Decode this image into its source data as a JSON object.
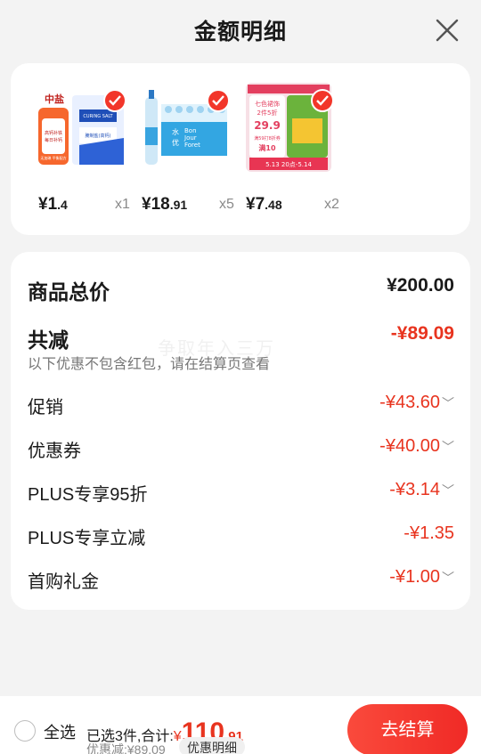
{
  "header": {
    "title": "金额明细",
    "close_icon": "close-icon"
  },
  "products": [
    {
      "name_icon": "salt-package-icon",
      "currency": "¥",
      "price_int": "1",
      "price_dec": ".4",
      "qty": "x1",
      "checked": true
    },
    {
      "name_icon": "water-bottles-icon",
      "currency": "¥",
      "price_int": "18",
      "price_dec": ".91",
      "qty": "x5",
      "checked": true
    },
    {
      "name_icon": "promo-pack-icon",
      "currency": "¥",
      "price_int": "7",
      "price_dec": ".48",
      "qty": "x2",
      "checked": true
    }
  ],
  "product_images": {
    "p1_brand": "中盐",
    "p1_badge_top": "高钙补铁",
    "p1_badge_bottom": "每日补钙",
    "p1_label_en": "CURING SALT",
    "p1_label_cn": "腌制盐(高钙)",
    "p1_side": "无加碘 平衡配方",
    "p2_line1": "水",
    "p2_line2": "Bon",
    "p2_line3": "Jour",
    "p2_line4": "Foret",
    "p2_line5": "优",
    "p3_top": "七色裙饰",
    "p3_deal": "2件5折",
    "p3_price": "29.9",
    "p3_sub": "满59打8折券",
    "p3_tag": "满10",
    "p3_date": "5.13 20点-5.14"
  },
  "summary": {
    "total_label": "商品总价",
    "total_value": "¥200.00",
    "reduce_label": "共减",
    "reduce_value": "-¥89.09",
    "note": "以下优惠不包含红包，请在结算页查看",
    "watermark": "争取年入三万"
  },
  "discounts": [
    {
      "label": "促销",
      "value": "-¥43.60",
      "expandable": true
    },
    {
      "label": "优惠券",
      "value": "-¥40.00",
      "expandable": true
    },
    {
      "label": "PLUS专享95折",
      "value": "-¥3.14",
      "expandable": true
    },
    {
      "label": "PLUS专享立减",
      "value": "-¥1.35",
      "expandable": false
    },
    {
      "label": "首购礼金",
      "value": "-¥1.00",
      "expandable": true
    }
  ],
  "bottom": {
    "select_all": "全选",
    "selected_text": "已选3件,合计:",
    "currency": "¥",
    "total_int": "110",
    "total_dec": ".91",
    "discount_line": "优惠减:¥89.09",
    "detail_button": "优惠明细",
    "checkout_button": "去结算"
  },
  "colors": {
    "accent_red": "#e8341f",
    "check_red": "#f2362a",
    "button_red": "#f02a26"
  }
}
